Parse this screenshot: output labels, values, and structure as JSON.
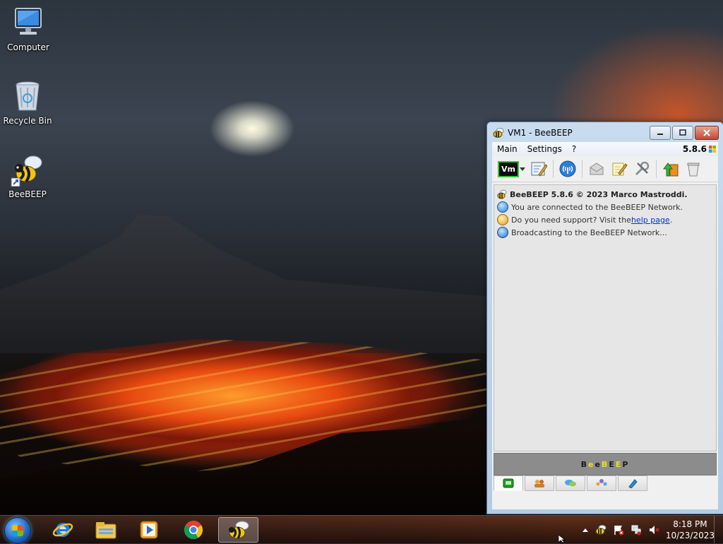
{
  "desktop": {
    "icons": [
      {
        "label": "Computer"
      },
      {
        "label": "Recycle Bin"
      },
      {
        "label": "BeeBEEP"
      }
    ]
  },
  "window": {
    "title": "VM1 - BeeBEEP",
    "menu": [
      "Main",
      "Settings",
      "?"
    ],
    "version": "5.8.6",
    "toolbar_user_badge": "Vm",
    "messages": {
      "m1": "BeeBEEP 5.8.6 © 2023 Marco Mastroddi.",
      "m2": "You are connected to the BeeBEEP Network.",
      "m3_prefix": "Do you need support? Visit the ",
      "m3_link": "help page",
      "m3_suffix": ".",
      "m4": "Broadcasting to the BeeBEEP Network..."
    },
    "banner": {
      "letters": [
        "B",
        "e",
        "e",
        "B",
        "E",
        "E",
        "P"
      ],
      "colors": [
        "#1a1a1a",
        "#e8e020",
        "#1a1a1a",
        "#e8e020",
        "#1a1a1a",
        "#e8e020",
        "#1a1a1a"
      ]
    }
  },
  "taskbar": {
    "time": "8:18 PM",
    "date": "10/23/2023"
  }
}
